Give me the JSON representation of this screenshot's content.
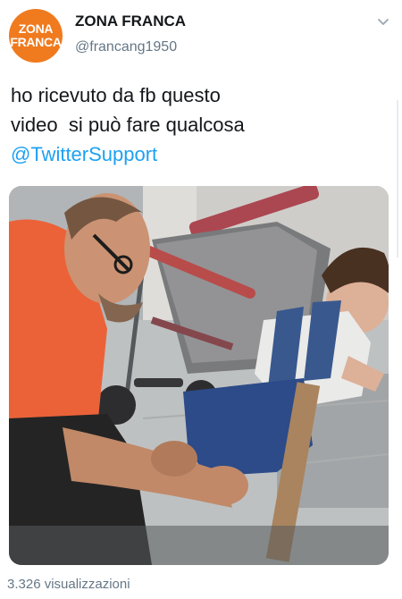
{
  "profile": {
    "avatar_line1": "ZONA",
    "avatar_line2": "FRANCA",
    "display_name": "ZONA FRANCA",
    "handle": "@francang1950"
  },
  "tweet": {
    "line1": "ho ricevuto da fb questo",
    "line2": "video  si può fare qualcosa",
    "mention": "@TwitterSupport"
  },
  "stats": {
    "views": "3.326 visualizzazioni"
  },
  "colors": {
    "brand_orange": "#f07a1e",
    "link_blue": "#1da1f2",
    "muted_gray": "#657786"
  },
  "icons": {
    "menu": "chevron-down-icon"
  }
}
